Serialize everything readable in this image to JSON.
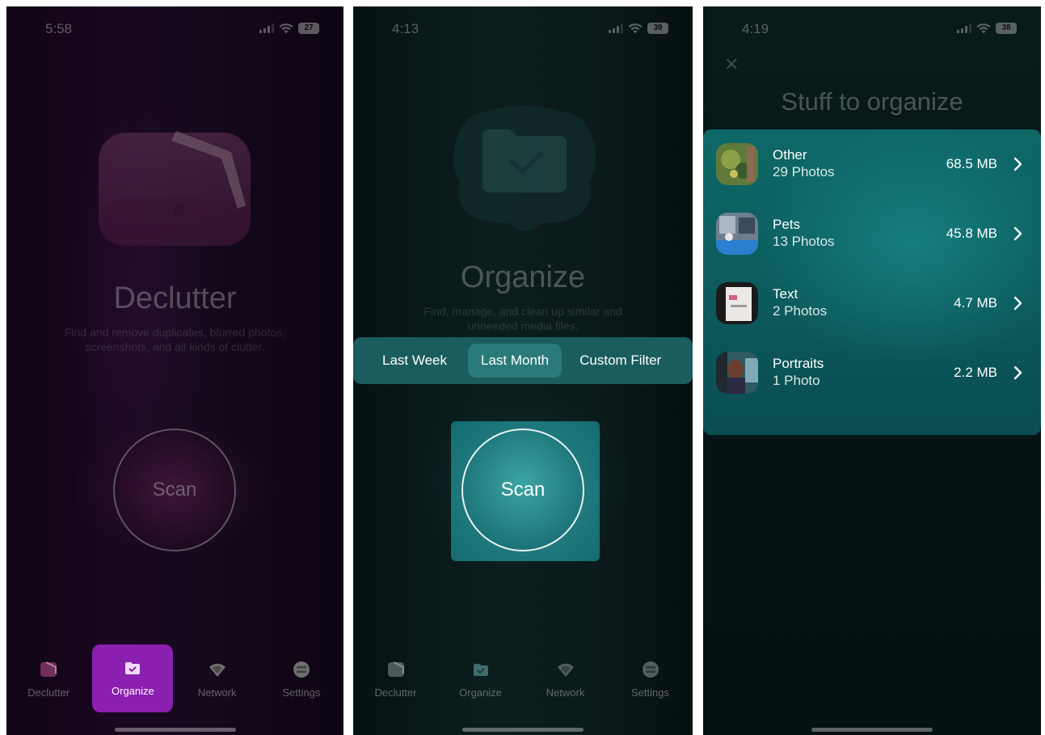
{
  "screen1": {
    "status": {
      "time": "5:58",
      "battery": "27"
    },
    "title": "Declutter",
    "description": "Find and remove duplicates, blurred photos, screenshots, and all kinds of clutter.",
    "scan_label": "Scan",
    "tabs": [
      {
        "label": "Declutter",
        "icon": "declutter-icon"
      },
      {
        "label": "Organize",
        "icon": "organize-icon",
        "selected": true
      },
      {
        "label": "Network",
        "icon": "network-icon"
      },
      {
        "label": "Settings",
        "icon": "settings-icon"
      }
    ],
    "highlight_color": "#8a1fb0"
  },
  "screen2": {
    "status": {
      "time": "4:13",
      "battery": "39"
    },
    "title": "Organize",
    "description": "Find, manage, and clean up similar and unneeded media files.",
    "filters": [
      "Last Week",
      "Last Month",
      "Custom Filter"
    ],
    "selected_filter": "Last Month",
    "scan_label": "Scan",
    "tabs": [
      {
        "label": "Declutter",
        "icon": "declutter-icon"
      },
      {
        "label": "Organize",
        "icon": "organize-icon"
      },
      {
        "label": "Network",
        "icon": "network-icon"
      },
      {
        "label": "Settings",
        "icon": "settings-icon"
      }
    ],
    "highlight_color": "#1f8d90"
  },
  "screen3": {
    "status": {
      "time": "4:19",
      "battery": "38"
    },
    "close_icon": "close-icon",
    "title": "Stuff to organize",
    "categories": [
      {
        "name": "Other",
        "count": "29 Photos",
        "size": "68.5 MB"
      },
      {
        "name": "Pets",
        "count": "13 Photos",
        "size": "45.8 MB"
      },
      {
        "name": "Text",
        "count": "2 Photos",
        "size": "4.7 MB"
      },
      {
        "name": "Portraits",
        "count": "1 Photo",
        "size": "2.2 MB"
      }
    ],
    "panel_color": "#0e6868"
  }
}
